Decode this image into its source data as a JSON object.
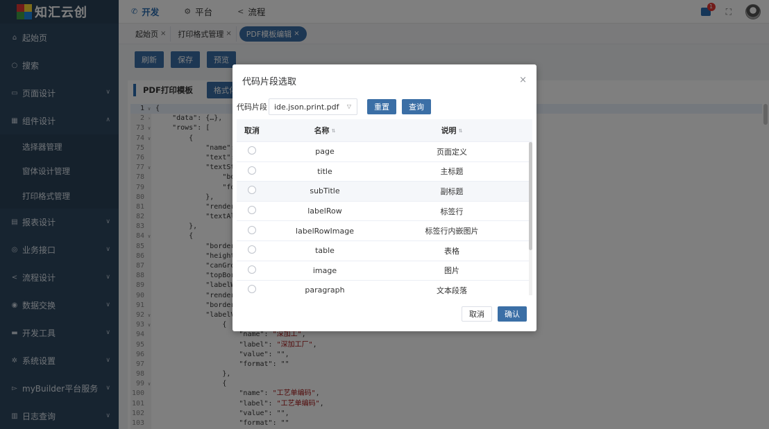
{
  "app": {
    "brand": "知汇云创"
  },
  "sidebar": {
    "items": [
      {
        "label": "起始页",
        "icon": "home-icon",
        "glyph": "⌂"
      },
      {
        "label": "搜索",
        "icon": "search-icon",
        "glyph": "○"
      },
      {
        "label": "页面设计",
        "icon": "page-icon",
        "glyph": "▭",
        "arrow": "∨"
      },
      {
        "label": "组件设计",
        "icon": "grid-icon",
        "glyph": "▦",
        "arrow": "∧"
      }
    ],
    "sub_items": [
      {
        "label": "选择器管理"
      },
      {
        "label": "窗体设计管理"
      },
      {
        "label": "打印格式管理"
      }
    ],
    "items2": [
      {
        "label": "报表设计",
        "icon": "report-icon",
        "glyph": "▤",
        "arrow": "∨"
      },
      {
        "label": "业务接口",
        "icon": "interface-icon",
        "glyph": "◎",
        "arrow": "∨"
      },
      {
        "label": "流程设计",
        "icon": "flow-icon",
        "glyph": "<",
        "arrow": "∨"
      },
      {
        "label": "数据交换",
        "icon": "database-icon",
        "glyph": "◉",
        "arrow": "∨"
      },
      {
        "label": "开发工具",
        "icon": "toolbox-icon",
        "glyph": "▬",
        "arrow": "∨"
      },
      {
        "label": "系统设置",
        "icon": "gear-icon",
        "glyph": "✲",
        "arrow": "∨"
      },
      {
        "label": "myBuilder平台服务",
        "icon": "service-icon",
        "glyph": "▻",
        "arrow": "∨"
      },
      {
        "label": "日志查询",
        "icon": "log-icon",
        "glyph": "▥",
        "arrow": "∨"
      }
    ]
  },
  "topbar": {
    "nav": [
      {
        "label": "开发",
        "glyph": "✆"
      },
      {
        "label": "平台",
        "glyph": "⚙"
      },
      {
        "label": "流程",
        "glyph": "<"
      }
    ],
    "badge": "1",
    "fullscreen_glyph": "⛶"
  },
  "tabs": [
    {
      "label": "起始页"
    },
    {
      "label": "打印格式管理"
    },
    {
      "label": "PDF模板编辑"
    }
  ],
  "tab_close": "×",
  "toolbar": {
    "refresh": "刷新",
    "save": "保存",
    "preview": "预览"
  },
  "editor": {
    "title": "PDF打印模板",
    "format_button": "格式化",
    "lines": [
      {
        "n": "1",
        "f": "∨",
        "t": "{"
      },
      {
        "n": "2",
        "f": "›",
        "t": "    \"data\": {…},"
      },
      {
        "n": "73",
        "f": "∨",
        "t": "    \"rows\": ["
      },
      {
        "n": "74",
        "f": "∨",
        "t": "        {"
      },
      {
        "n": "75",
        "f": "",
        "t": "            \"name\": \""
      },
      {
        "n": "76",
        "f": "",
        "t": "            \"text\": \""
      },
      {
        "n": "77",
        "f": "∨",
        "t": "            \"textSty"
      },
      {
        "n": "78",
        "f": "",
        "t": "                \"bol"
      },
      {
        "n": "79",
        "f": "",
        "t": "                \"fon"
      },
      {
        "n": "80",
        "f": "",
        "t": "            },"
      },
      {
        "n": "81",
        "f": "",
        "t": "            \"renderTy"
      },
      {
        "n": "82",
        "f": "",
        "t": "            \"textAli"
      },
      {
        "n": "83",
        "f": "",
        "t": "        },"
      },
      {
        "n": "84",
        "f": "∨",
        "t": "        {"
      },
      {
        "n": "85",
        "f": "",
        "t": "            \"border\""
      },
      {
        "n": "86",
        "f": "",
        "t": "            \"height\""
      },
      {
        "n": "87",
        "f": "",
        "t": "            \"canGrow"
      },
      {
        "n": "88",
        "f": "",
        "t": "            \"topBord"
      },
      {
        "n": "89",
        "f": "",
        "t": "            \"labelWi"
      },
      {
        "n": "90",
        "f": "",
        "t": "            \"renderTy"
      },
      {
        "n": "91",
        "f": "",
        "t": "            \"borderCo"
      },
      {
        "n": "92",
        "f": "∨",
        "t": "            \"labelVal"
      },
      {
        "n": "93",
        "f": "∨",
        "t": "                {"
      },
      {
        "n": "94",
        "f": "",
        "t": "                    \"name\": \"深加工\","
      },
      {
        "n": "95",
        "f": "",
        "t": "                    \"label\": \"深加工厂\","
      },
      {
        "n": "96",
        "f": "",
        "t": "                    \"value\": \"\","
      },
      {
        "n": "97",
        "f": "",
        "t": "                    \"format\": \"\""
      },
      {
        "n": "98",
        "f": "",
        "t": "                },"
      },
      {
        "n": "99",
        "f": "∨",
        "t": "                {"
      },
      {
        "n": "100",
        "f": "",
        "t": "                    \"name\": \"工艺单编码\","
      },
      {
        "n": "101",
        "f": "",
        "t": "                    \"label\": \"工艺单编码\","
      },
      {
        "n": "102",
        "f": "",
        "t": "                    \"value\": \"\","
      },
      {
        "n": "103",
        "f": "",
        "t": "                    \"format\": \"\""
      }
    ]
  },
  "modal": {
    "title": "代码片段选取",
    "close_glyph": "×",
    "filter_label": "代码片段",
    "filter_value": "ide.json.print.pdf",
    "select_chev": "▽",
    "reset": "重置",
    "query": "查询",
    "columns": {
      "select": "取消",
      "name": "名称",
      "desc": "说明"
    },
    "sort_glyph": "⇅",
    "rows": [
      {
        "name": "page",
        "desc": "页面定义"
      },
      {
        "name": "title",
        "desc": "主标题"
      },
      {
        "name": "subTitle",
        "desc": "副标题"
      },
      {
        "name": "labelRow",
        "desc": "标签行"
      },
      {
        "name": "labelRowImage",
        "desc": "标签行内嵌图片"
      },
      {
        "name": "table",
        "desc": "表格"
      },
      {
        "name": "image",
        "desc": "图片"
      },
      {
        "name": "paragraph",
        "desc": "文本段落"
      }
    ],
    "cancel": "取消",
    "confirm": "确认"
  }
}
